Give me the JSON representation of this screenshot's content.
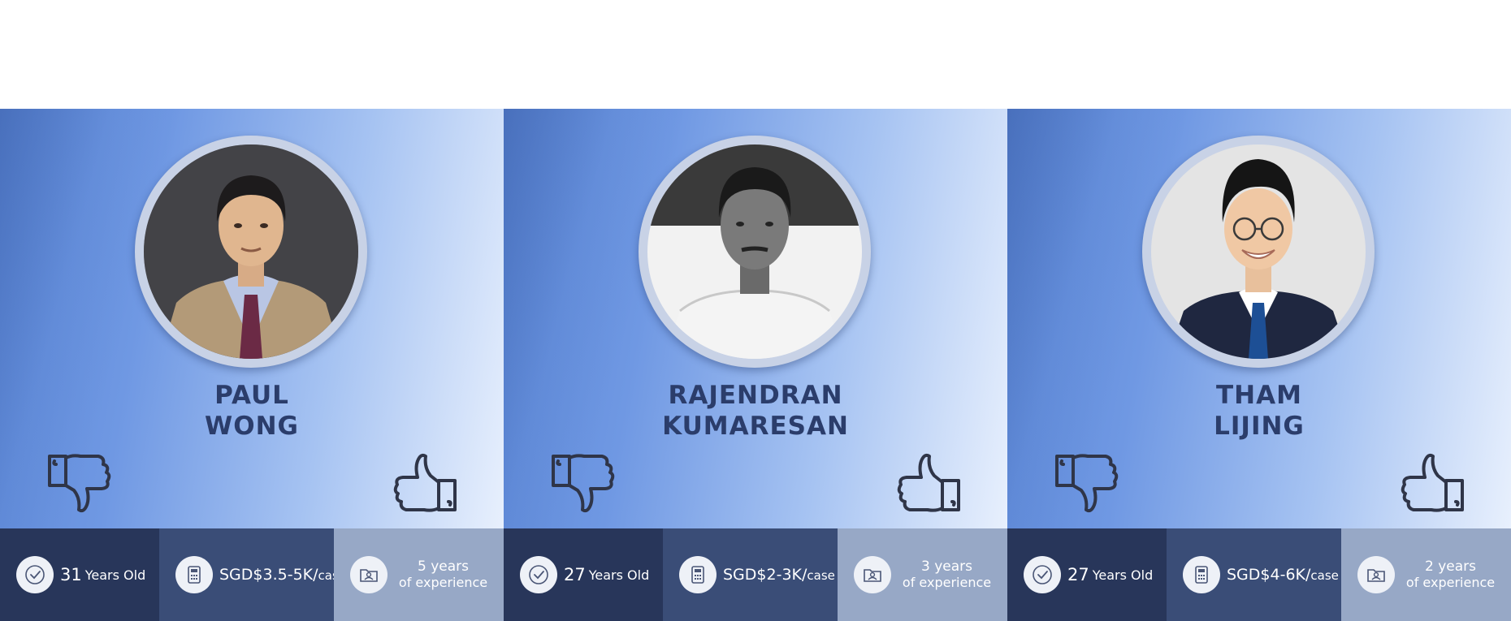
{
  "profiles": [
    {
      "name_first": "PAUL",
      "name_last": "WONG",
      "age_number": "31",
      "age_unit": "Years Old",
      "price_value": "SGD$3.5-5K/",
      "price_unit": "case",
      "experience_line1": "5 years",
      "experience_line2": "of experience",
      "photo_style": "color"
    },
    {
      "name_first": "RAJENDRAN",
      "name_last": "KUMARESAN",
      "age_number": "27",
      "age_unit": "Years Old",
      "price_value": "SGD$2-3K/",
      "price_unit": "case",
      "experience_line1": "3 years",
      "experience_line2": "of experience",
      "photo_style": "grayscale"
    },
    {
      "name_first": "THAM",
      "name_last": "LIJING",
      "age_number": "27",
      "age_unit": "Years Old",
      "price_value": "SGD$4-6K/",
      "price_unit": "case",
      "experience_line1": "2 years",
      "experience_line2": "of experience",
      "photo_style": "color"
    }
  ],
  "icons": {
    "dislike": "thumbs-down-icon",
    "like": "thumbs-up-icon",
    "age": "check-circle-icon",
    "price": "calculator-icon",
    "experience": "portfolio-icon"
  },
  "colors": {
    "name_text": "#2b3d6b",
    "age_panel": "#28365a",
    "price_panel": "#3a4d77",
    "experience_panel": "#97a8c6"
  }
}
